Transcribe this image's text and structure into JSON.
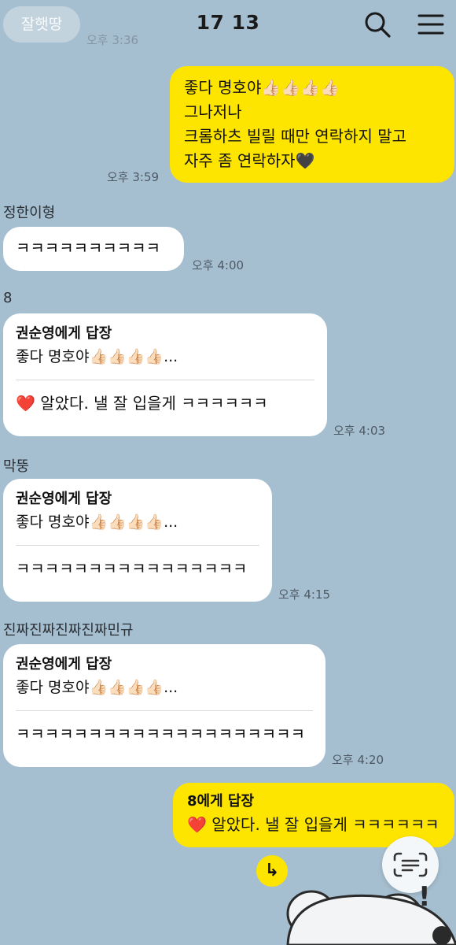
{
  "header": {
    "back_label": "잘햇땅",
    "ghost_time": "오후 3:36",
    "title": "17 13"
  },
  "messages": [
    {
      "type": "out",
      "lines": [
        "좋다 명호야👍🏻👍🏻👍🏻👍🏻",
        "그나저나",
        "크롬하츠 빌릴 때만 연락하지 말고",
        "자주 좀 연락하자🖤"
      ],
      "time": "오후 3:59"
    },
    {
      "type": "in",
      "sender": "정한이형",
      "text": "ㅋㅋㅋㅋㅋㅋㅋㅋㅋㅋ",
      "time": "오후 4:00"
    },
    {
      "type": "in-reply",
      "sender": "8",
      "reply_to": "권순영에게 답장",
      "quote": "좋다 명호야👍🏻👍🏻👍🏻👍🏻...",
      "text": "❤️ 알았다. 낼 잘 입을게 ㅋㅋㅋㅋㅋㅋ",
      "time": "오후 4:03"
    },
    {
      "type": "in-reply",
      "sender": "막뚱",
      "reply_to": "권순영에게 답장",
      "quote": "좋다 명호야👍🏻👍🏻👍🏻👍🏻...",
      "text": "ㅋㅋㅋㅋㅋㅋㅋㅋㅋㅋㅋㅋㅋㅋㅋㅋ",
      "time": "오후 4:15"
    },
    {
      "type": "in-reply",
      "sender": "진짜진짜진짜진짜민규",
      "reply_to": "권순영에게 답장",
      "quote": "좋다 명호야👍🏻👍🏻👍🏻👍🏻...",
      "text": "ㅋㅋㅋㅋㅋㅋㅋㅋㅋㅋㅋㅋㅋㅋㅋㅋㅋㅋㅋㅋ",
      "time": "오후 4:20"
    },
    {
      "type": "out-reply",
      "reply_to": "8에게 답장",
      "text": "❤️ 알았다. 낼 잘 입을게 ㅋㅋㅋㅋㅋㅋ"
    }
  ],
  "icons": {
    "search": "search-icon",
    "menu": "menu-icon",
    "scroll": "scroll-down-icon",
    "scan": "text-scan-icon"
  },
  "colors": {
    "background": "#a6bfd0",
    "my_bubble": "#fee500",
    "their_bubble": "#ffffff"
  }
}
